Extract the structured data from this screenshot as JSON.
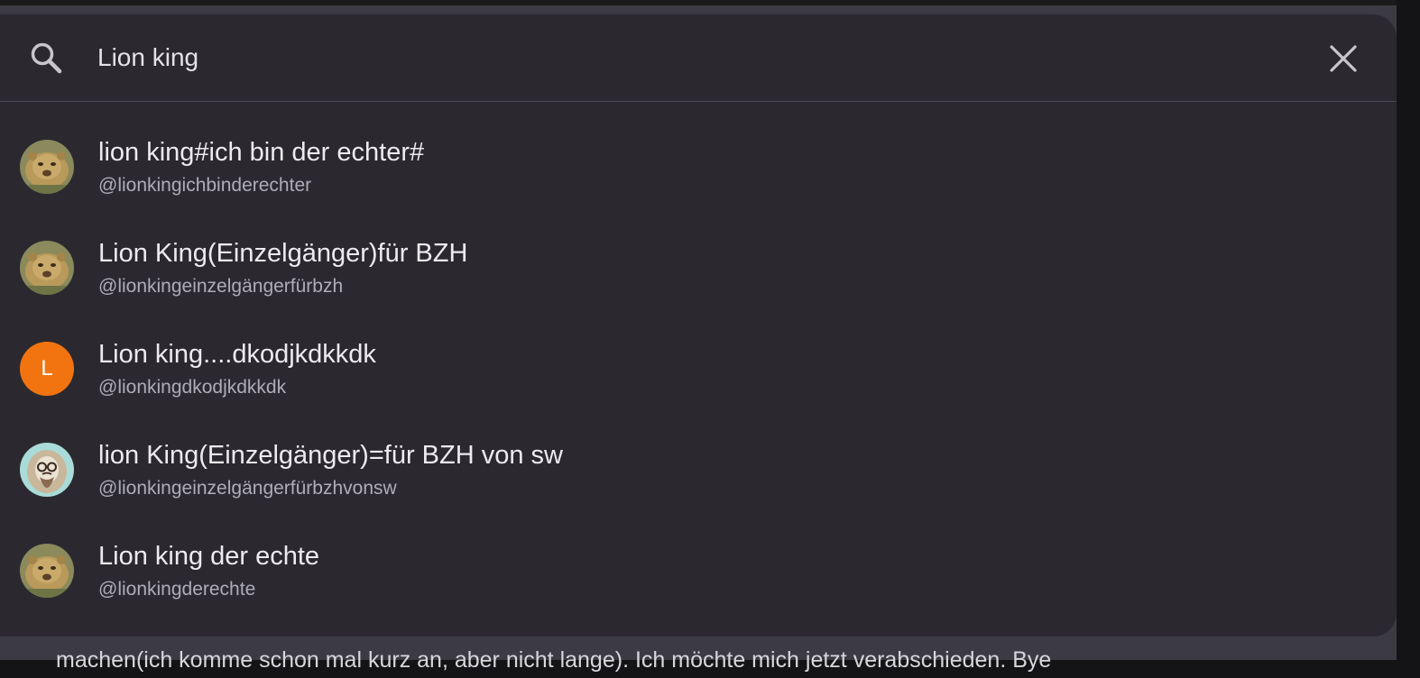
{
  "search": {
    "value": "Lion king",
    "icon": "search-icon",
    "close_icon": "close-icon"
  },
  "results": [
    {
      "name": "lion king#ich bin der echter#",
      "handle": "@lionkingichbinderechter",
      "avatar": "lion-cub-photo"
    },
    {
      "name": "Lion King(Einzelgänger)für BZH",
      "handle": "@lionkingeinzelgängerfürbzh",
      "avatar": "lion-cub-photo"
    },
    {
      "name": "Lion king....dkodjkdkkdk",
      "handle": "@lionkingdkodjkdkkdk",
      "avatar_letter": "L",
      "avatar_color": "#f27410"
    },
    {
      "name": "lion King(Einzelgänger)=für BZH von sw",
      "handle": "@lionkingeinzelgängerfürbzhvonsw",
      "avatar": "hipster-lion-illustration"
    },
    {
      "name": "Lion king der echte",
      "handle": "@lionkingderechte",
      "avatar": "lion-cub-photo"
    }
  ],
  "background": {
    "text": "machen(ich komme schon mal kurz an, aber nicht lange). Ich möchte mich jetzt verabschieden. Bye"
  },
  "colors": {
    "panel": "#2b292f",
    "accent_avatar": "#f27410",
    "text_primary": "#ecebf0",
    "text_secondary": "#aeacb5"
  }
}
